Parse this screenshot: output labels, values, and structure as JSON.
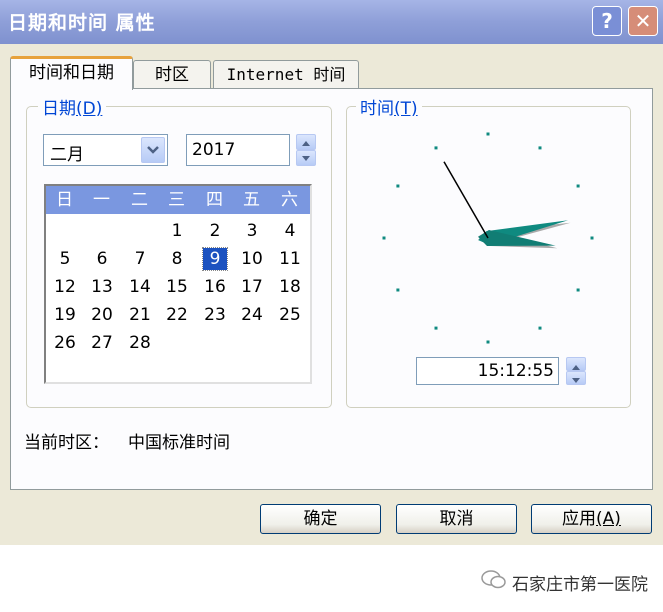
{
  "window": {
    "title": "日期和时间 属性",
    "help_label": "?",
    "close_label": "✕"
  },
  "tabs": [
    {
      "label": "时间和日期",
      "active": true
    },
    {
      "label": "时区",
      "active": false
    },
    {
      "label": "Internet 时间",
      "active": false
    }
  ],
  "date_group": {
    "label": "日期",
    "accel_label": "(D)",
    "month_value": "二月",
    "year_value": "2017"
  },
  "calendar": {
    "weekdays": [
      "日",
      "一",
      "二",
      "三",
      "四",
      "五",
      "六"
    ],
    "rows": [
      [
        "",
        "",
        "",
        "1",
        "2",
        "3",
        "4"
      ],
      [
        "5",
        "6",
        "7",
        "8",
        "9",
        "10",
        "11"
      ],
      [
        "12",
        "13",
        "14",
        "15",
        "16",
        "17",
        "18"
      ],
      [
        "19",
        "20",
        "21",
        "22",
        "23",
        "24",
        "25"
      ],
      [
        "26",
        "27",
        "28",
        "",
        "",
        "",
        ""
      ]
    ],
    "selected_day": "9",
    "header_color": "#7a97e0",
    "selected_color": "#1c52c0"
  },
  "time_group": {
    "label": "时间",
    "accel_label": "(T)",
    "time_value": "15:12:55",
    "clock": {
      "hour": 15,
      "minute": 12,
      "second": 55
    }
  },
  "timezone": {
    "label": "当前时区：",
    "value": "中国标准时间"
  },
  "buttons": {
    "ok_label": "确定",
    "cancel_label": "取消",
    "apply_label": "应用",
    "apply_accel": "(A)"
  },
  "watermark": {
    "text": "石家庄市第一医院",
    "icon": "wechat-icon"
  },
  "colors": {
    "title_bar": "#8e9fd8",
    "dialog_bg": "#ece9d8",
    "group_label": "#0046d5",
    "clock_hand": "#0f8a80"
  }
}
